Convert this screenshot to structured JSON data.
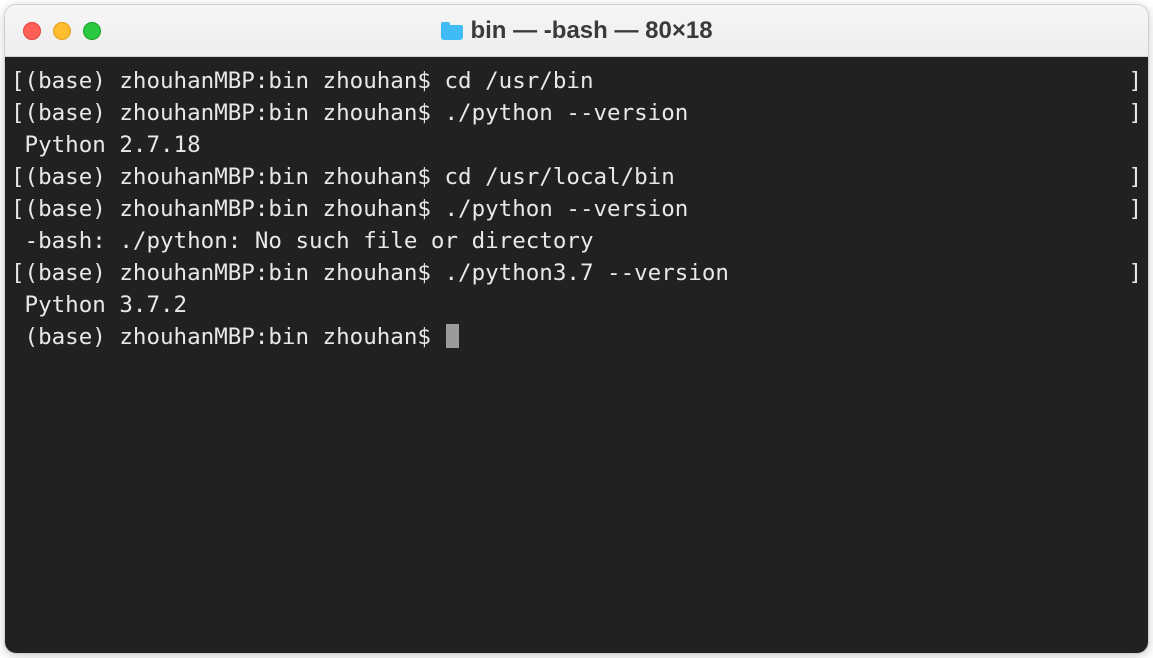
{
  "window": {
    "title": "bin — -bash — 80×18"
  },
  "terminal": {
    "lb": "[",
    "rb": "]",
    "lines": [
      {
        "prompt": "(base) zhouhanMBP:bin zhouhan$ ",
        "cmd": "cd /usr/bin",
        "bracket": true
      },
      {
        "prompt": "(base) zhouhanMBP:bin zhouhan$ ",
        "cmd": "./python --version",
        "bracket": true
      },
      {
        "output": " Python 2.7.18"
      },
      {
        "prompt": "(base) zhouhanMBP:bin zhouhan$ ",
        "cmd": "cd /usr/local/bin",
        "bracket": true
      },
      {
        "prompt": "(base) zhouhanMBP:bin zhouhan$ ",
        "cmd": "./python --version",
        "bracket": true
      },
      {
        "output": " -bash: ./python: No such file or directory"
      },
      {
        "prompt": "(base) zhouhanMBP:bin zhouhan$ ",
        "cmd": "./python3.7 --version",
        "bracket": true
      },
      {
        "output": " Python 3.7.2"
      },
      {
        "prompt": " (base) zhouhanMBP:bin zhouhan$ ",
        "cmd": "",
        "cursor": true,
        "bracket": false
      }
    ]
  }
}
